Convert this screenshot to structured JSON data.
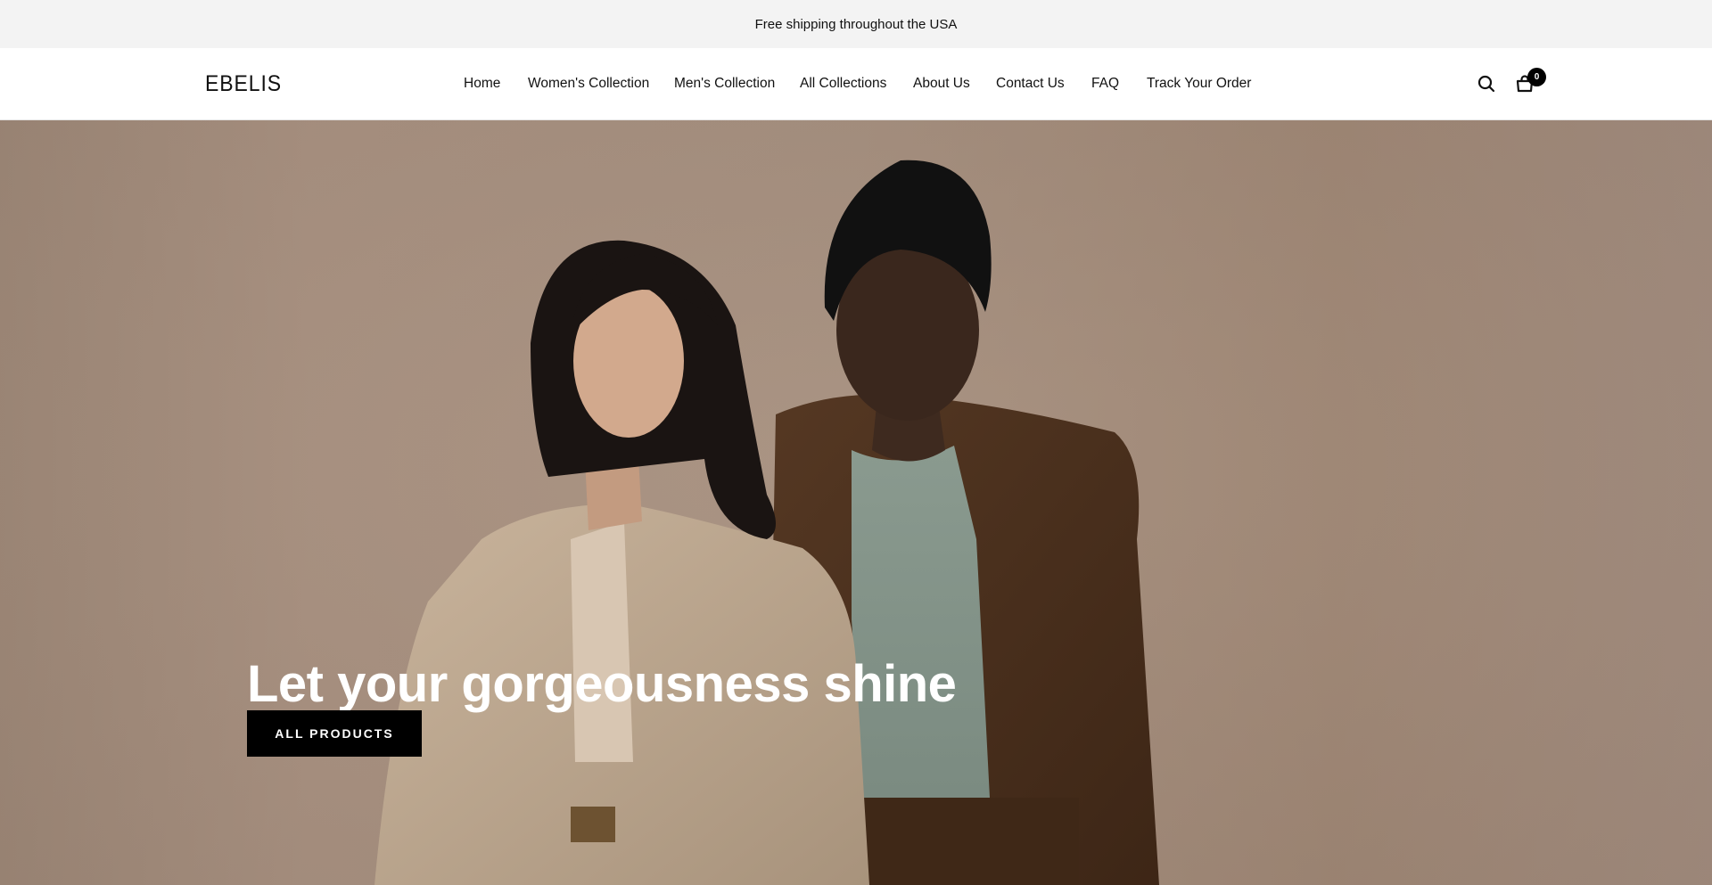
{
  "announcement": {
    "text": "Free shipping throughout the USA"
  },
  "header": {
    "logo": "EBELIS",
    "nav": [
      {
        "label": "Home"
      },
      {
        "label": "Women's Collection"
      },
      {
        "label": "Men's Collection"
      },
      {
        "label": "All Collections"
      },
      {
        "label": "About Us"
      },
      {
        "label": "Contact Us"
      },
      {
        "label": "FAQ"
      },
      {
        "label": "Track Your Order"
      }
    ],
    "icons": {
      "search": "search-icon",
      "cart": "shopping-bag-icon"
    },
    "cart_count": "0"
  },
  "hero": {
    "title": "Let your gorgeousness shine",
    "cta_label": "ALL PRODUCTS",
    "colors": {
      "backdrop": "#a59080",
      "cta_background": "#000000",
      "cta_text": "#ffffff"
    }
  }
}
